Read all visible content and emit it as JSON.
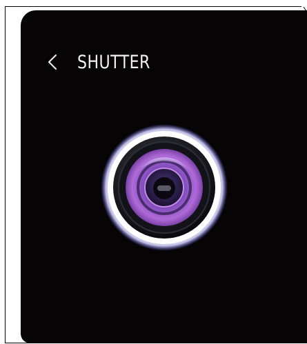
{
  "header": {
    "title": "SHUTTER",
    "back_icon": "chevron-left-icon"
  },
  "shutter": {
    "icon": "camera-lens-icon"
  },
  "colors": {
    "screen_bg": "#060404",
    "title_text": "#f2f2f2",
    "lens_purple": "#9b5cc8",
    "lens_ring": "#ffffff"
  }
}
